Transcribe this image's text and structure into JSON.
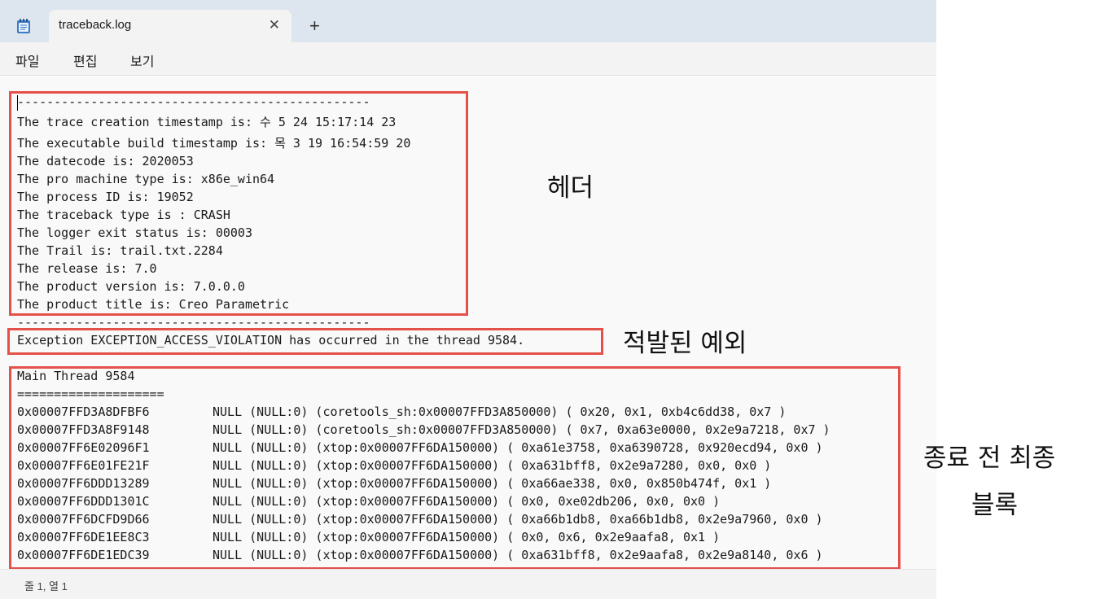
{
  "window": {
    "tab_title": "traceback.log",
    "tab_close_glyph": "✕",
    "new_tab_glyph": "+",
    "app_icon": "notepad-icon"
  },
  "menu": [
    "파일",
    "편집",
    "보기"
  ],
  "log": {
    "header_lines": [
      "------------------------------------------------",
      "The trace creation timestamp is: 수 5 24 15:17:14 23",
      "The executable build timestamp is: 목 3 19 16:54:59 20",
      "The datecode is: 2020053",
      "The pro machine type is: x86e_win64",
      "The process ID is: 19052",
      "The traceback type is : CRASH",
      "The logger exit status is: 00003",
      "The Trail is: trail.txt.2284",
      "The release is: 7.0",
      "The product version is: 7.0.0.0",
      "The product title is: Creo Parametric",
      "------------------------------------------------"
    ],
    "exception_line": "Exception EXCEPTION_ACCESS_VIOLATION has occurred in the thread 9584.",
    "thread_title": "Main Thread 9584",
    "thread_separator": "====================",
    "frames": [
      {
        "addr": "0x00007FFD3A8DFBF6",
        "info": "NULL (NULL:0) (coretools_sh:0x00007FFD3A850000) ( 0x20, 0x1, 0xb4c6dd38, 0x7 )"
      },
      {
        "addr": "0x00007FFD3A8F9148",
        "info": "NULL (NULL:0) (coretools_sh:0x00007FFD3A850000) ( 0x7, 0xa63e0000, 0x2e9a7218, 0x7 )"
      },
      {
        "addr": "0x00007FF6E02096F1",
        "info": "NULL (NULL:0) (xtop:0x00007FF6DA150000) ( 0xa61e3758, 0xa6390728, 0x920ecd94, 0x0 )"
      },
      {
        "addr": "0x00007FF6E01FE21F",
        "info": "NULL (NULL:0) (xtop:0x00007FF6DA150000) ( 0xa631bff8, 0x2e9a7280, 0x0, 0x0 )"
      },
      {
        "addr": "0x00007FF6DDD13289",
        "info": "NULL (NULL:0) (xtop:0x00007FF6DA150000) ( 0xa66ae338, 0x0, 0x850b474f, 0x1 )"
      },
      {
        "addr": "0x00007FF6DDD1301C",
        "info": "NULL (NULL:0) (xtop:0x00007FF6DA150000) ( 0x0, 0xe02db206, 0x0, 0x0 )"
      },
      {
        "addr": "0x00007FF6DCFD9D66",
        "info": "NULL (NULL:0) (xtop:0x00007FF6DA150000) ( 0xa66b1db8, 0xa66b1db8, 0x2e9a7960, 0x0 )"
      },
      {
        "addr": "0x00007FF6DE1EE8C3",
        "info": "NULL (NULL:0) (xtop:0x00007FF6DA150000) ( 0x0, 0x6, 0x2e9aafa8, 0x1 )"
      },
      {
        "addr": "0x00007FF6DE1EDC39",
        "info": "NULL (NULL:0) (xtop:0x00007FF6DA150000) ( 0xa631bff8, 0x2e9aafa8, 0x2e9a8140, 0x6 )"
      }
    ]
  },
  "annotations": {
    "header": "헤더",
    "exception": "적발된 예외",
    "last_block_line1": "종료 전 최종",
    "last_block_line2": "블록",
    "box_color": "#e4504a"
  },
  "status": {
    "position": "줄 1, 열 1"
  }
}
